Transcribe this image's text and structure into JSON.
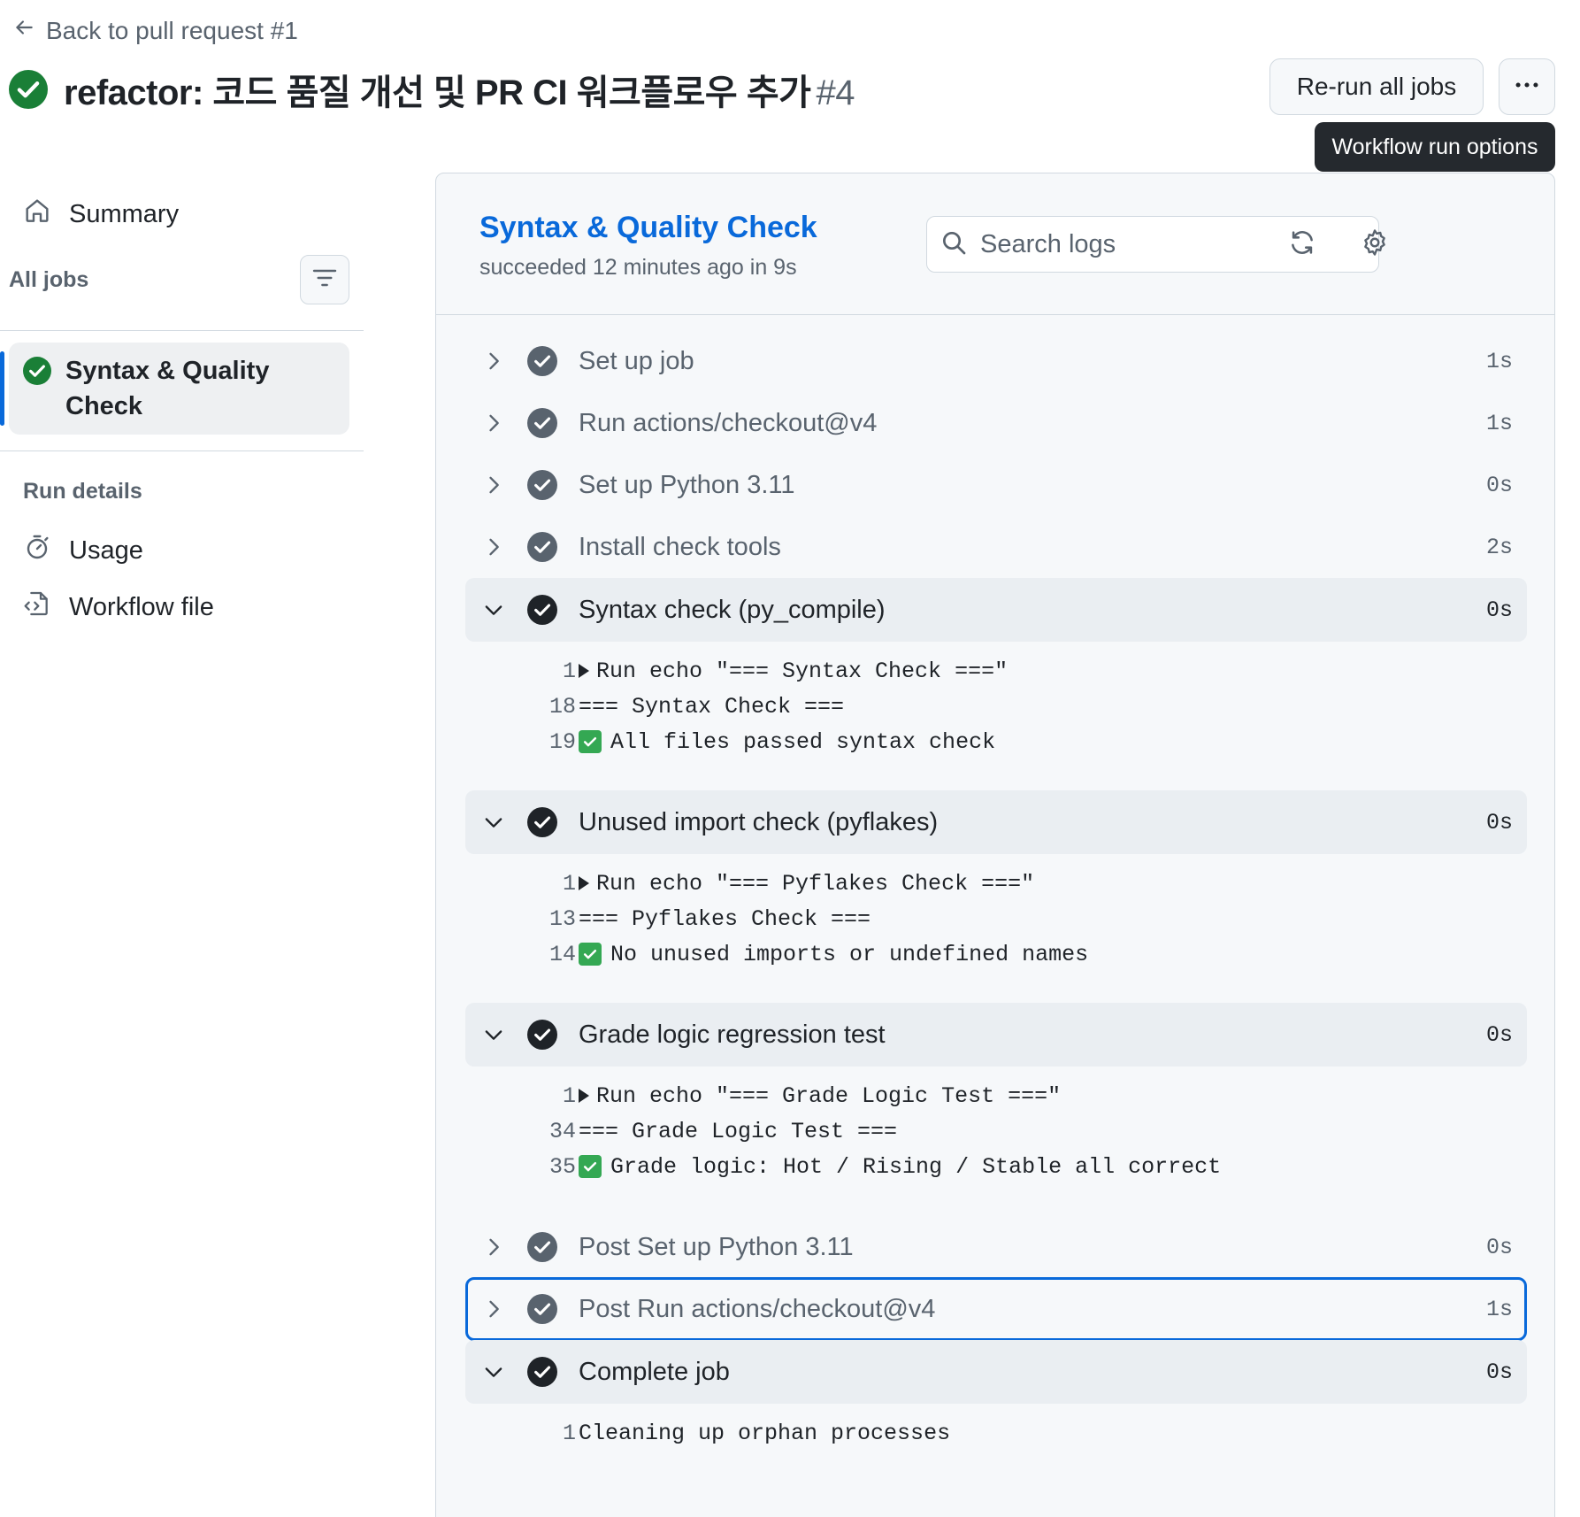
{
  "header": {
    "back_label": "Back to pull request #1",
    "title": "refactor: 코드 품질 개선 및 PR CI 워크플로우 추가",
    "run_number": "#4",
    "rerun_label": "Re-run all jobs",
    "tooltip": "Workflow run options"
  },
  "sidebar": {
    "summary_label": "Summary",
    "all_jobs_label": "All jobs",
    "job_label": "Syntax & Quality Check",
    "run_details_label": "Run details",
    "usage_label": "Usage",
    "workflow_file_label": "Workflow file"
  },
  "job": {
    "title": "Syntax & Quality Check",
    "status": "succeeded 12 minutes ago in 9s",
    "search_placeholder": "Search logs"
  },
  "steps": [
    {
      "name": "Set up job",
      "duration": "1s"
    },
    {
      "name": "Run actions/checkout@v4",
      "duration": "1s"
    },
    {
      "name": "Set up Python 3.11",
      "duration": "0s"
    },
    {
      "name": "Install check tools",
      "duration": "2s"
    },
    {
      "name": "Syntax check (py_compile)",
      "duration": "0s",
      "logs": [
        {
          "n": "1",
          "text": "Run echo \"=== Syntax Check ===\""
        },
        {
          "n": "18",
          "text": "=== Syntax Check ==="
        },
        {
          "n": "19",
          "text": "All files passed syntax check"
        }
      ]
    },
    {
      "name": "Unused import check (pyflakes)",
      "duration": "0s",
      "logs": [
        {
          "n": "1",
          "text": "Run echo \"=== Pyflakes Check ===\""
        },
        {
          "n": "13",
          "text": "=== Pyflakes Check ==="
        },
        {
          "n": "14",
          "text": "No unused imports or undefined names"
        }
      ]
    },
    {
      "name": "Grade logic regression test",
      "duration": "0s",
      "logs": [
        {
          "n": "1",
          "text": "Run echo \"=== Grade Logic Test ===\""
        },
        {
          "n": "34",
          "text": "=== Grade Logic Test ==="
        },
        {
          "n": "35",
          "text": "Grade logic: Hot / Rising / Stable all correct"
        }
      ]
    },
    {
      "name": "Post Set up Python 3.11",
      "duration": "0s"
    },
    {
      "name": "Post Run actions/checkout@v4",
      "duration": "1s"
    },
    {
      "name": "Complete job",
      "duration": "0s",
      "logs": [
        {
          "n": "1",
          "text": "Cleaning up orphan processes"
        }
      ]
    }
  ],
  "colors": {
    "success": "#1a7f37",
    "accent": "#0969da",
    "step_check": "#59636e",
    "expanded_check": "#1f2328"
  }
}
